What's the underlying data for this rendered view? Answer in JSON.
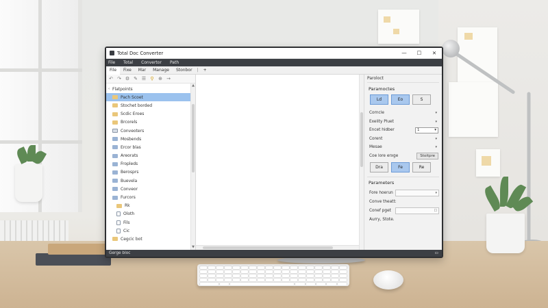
{
  "window": {
    "title": "Total Doc Converter",
    "controls": {
      "minimize": "—",
      "maximize": "☐",
      "close": "✕"
    }
  },
  "menu": [
    "File",
    "Total",
    "Convertor",
    "Path"
  ],
  "tabs": {
    "items": [
      "File",
      "Fixe",
      "Mar",
      "Manage",
      "Stonbor"
    ],
    "separator": "|",
    "add": "+"
  },
  "toolbar": {
    "icons": [
      "undo-icon",
      "redo-icon",
      "tool-icon",
      "edit-icon",
      "list-icon",
      "search-icon",
      "zoom-icon",
      "forward-icon"
    ]
  },
  "tree": {
    "root": "Flatpoints",
    "items": [
      {
        "label": "Pach Scoet",
        "icon": "folder",
        "selected": true,
        "indent": 1
      },
      {
        "label": "Stochet borded",
        "icon": "folder",
        "indent": 1
      },
      {
        "label": "Scdic Eroes",
        "icon": "folder",
        "indent": 1
      },
      {
        "label": "Brcorels",
        "icon": "folder",
        "indent": 1
      },
      {
        "label": "Conveoters",
        "icon": "pc",
        "indent": 1
      },
      {
        "label": "Mosbends",
        "icon": "folder-blue",
        "indent": 1
      },
      {
        "label": "Ercor blas",
        "icon": "folder-blue",
        "indent": 1
      },
      {
        "label": "Areorats",
        "icon": "folder-blue",
        "indent": 1
      },
      {
        "label": "Fropleds",
        "icon": "folder-blue",
        "indent": 1
      },
      {
        "label": "Berosprs",
        "icon": "folder-blue",
        "indent": 1
      },
      {
        "label": "Buevela",
        "icon": "folder-blue",
        "indent": 1
      },
      {
        "label": "Conveor",
        "icon": "folder-blue",
        "indent": 1
      },
      {
        "label": "Furcors",
        "icon": "folder-blue",
        "indent": 1
      },
      {
        "label": "Rk",
        "icon": "folder",
        "indent": 2
      },
      {
        "label": "Oloth",
        "icon": "doc",
        "indent": 2
      },
      {
        "label": "Fils",
        "icon": "doc",
        "indent": 2
      },
      {
        "label": "Cic",
        "icon": "doc",
        "indent": 2
      },
      {
        "label": "Cegcic bot",
        "icon": "folder",
        "indent": 1
      }
    ]
  },
  "right_panel": {
    "title": "Paroloct",
    "section1": "Paramoctes",
    "buttons1": [
      {
        "label": "Ld",
        "on": true
      },
      {
        "label": "Eo",
        "on": true
      },
      {
        "label": "S",
        "on": false
      }
    ],
    "rows": [
      {
        "label": "Corncle",
        "type": "dropdown",
        "arrow": "▾"
      },
      {
        "label": "Exelity Pluet",
        "type": "dropdown",
        "arrow": "▾"
      },
      {
        "label": "Encet hidber",
        "type": "select",
        "value": "1",
        "arrow": "▾"
      },
      {
        "label": "Corent",
        "type": "dropdown",
        "arrow": "▾"
      },
      {
        "label": "Mesae",
        "type": "dropdown",
        "arrow": "▾"
      },
      {
        "label": "Coe lore erxge",
        "type": "button",
        "value": "Stoitpre"
      }
    ],
    "buttons2": [
      {
        "label": "Dra",
        "on": false
      },
      {
        "label": "Fe",
        "on": true
      },
      {
        "label": "Re",
        "on": false
      }
    ],
    "section2": "Parameters",
    "fields": [
      {
        "label": "Fore hoerun",
        "type": "dropdown",
        "arrow": "▾"
      },
      {
        "label": "Conve theatt:",
        "type": "text"
      },
      {
        "label": "Conef pget",
        "type": "browse",
        "arrow": "☐"
      }
    ],
    "footer": "Aurry, Stote."
  },
  "status": {
    "text": "Gerge bloc",
    "icon": "▭"
  }
}
